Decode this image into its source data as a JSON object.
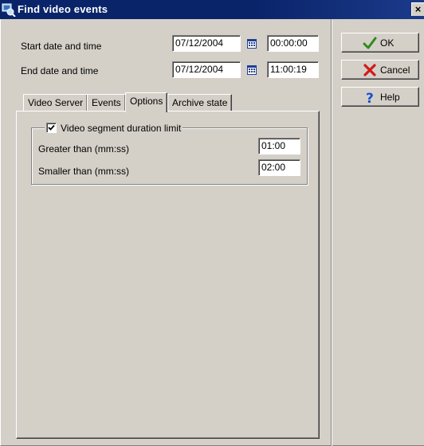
{
  "window": {
    "title": "Find video events",
    "close_glyph": "×"
  },
  "form": {
    "start": {
      "label": "Start date and time",
      "date": "07/12/2004",
      "time": "00:00:00"
    },
    "end": {
      "label": "End date and time",
      "date": "07/12/2004",
      "time": "11:00:19"
    }
  },
  "buttons": {
    "ok": {
      "label": "OK",
      "icon": "check-icon"
    },
    "cancel": {
      "label": "Cancel",
      "icon": "x-icon"
    },
    "help": {
      "label": "Help",
      "icon": "question-icon"
    }
  },
  "tabs": [
    {
      "label": "Video Server"
    },
    {
      "label": "Events"
    },
    {
      "label": "Options",
      "active": true
    },
    {
      "label": "Archive state"
    }
  ],
  "options": {
    "group_label": "Video segment duration limit",
    "checked": true,
    "greater": {
      "label": "Greater than (mm:ss)",
      "value": "01:00"
    },
    "smaller": {
      "label": "Smaller than (mm:ss)",
      "value": "02:00"
    }
  },
  "colors": {
    "titlebar": "#0a246a",
    "face": "#d4d0c8",
    "ok_green": "#2e8b1e",
    "cancel_red": "#d11a1a",
    "help_blue": "#1a4fd1"
  }
}
